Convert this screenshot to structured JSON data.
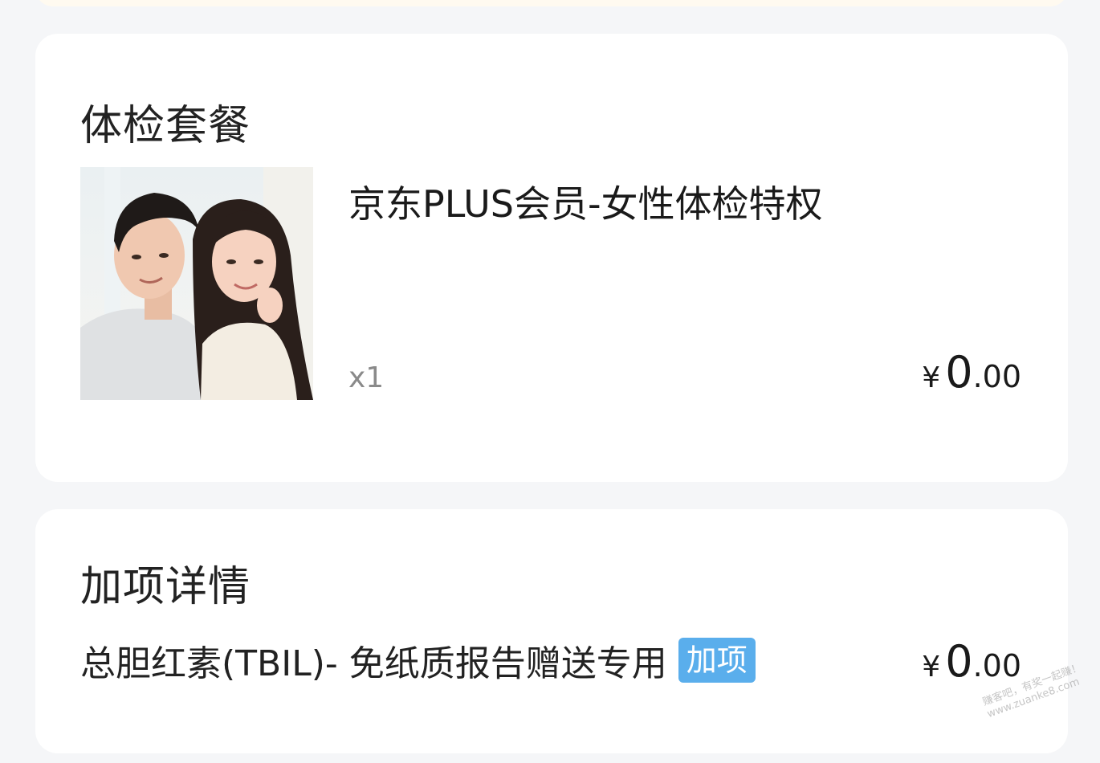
{
  "package_section": {
    "title": "体检套餐",
    "product": {
      "name": "京东PLUS会员-女性体检特权",
      "quantity": "x1",
      "image_alt": "product-photo-couple",
      "price": {
        "currency": "¥",
        "integer": "0",
        "decimal": ".00"
      }
    }
  },
  "addon_section": {
    "title": "加项详情",
    "item": {
      "name": "总胆红素(TBIL)- 免纸质报告赠送专用",
      "tag": "加项",
      "price": {
        "currency": "¥",
        "integer": "0",
        "decimal": ".00"
      }
    }
  },
  "watermark": {
    "line1": "赚客吧，有奖一起赚！",
    "line2": "www.zuanke8.com"
  },
  "colors": {
    "page_background": "#f5f6f8",
    "card_background": "#ffffff",
    "tag_background": "#5aaeec",
    "tag_text": "#ffffff",
    "quantity_text": "#8a8a8a"
  }
}
